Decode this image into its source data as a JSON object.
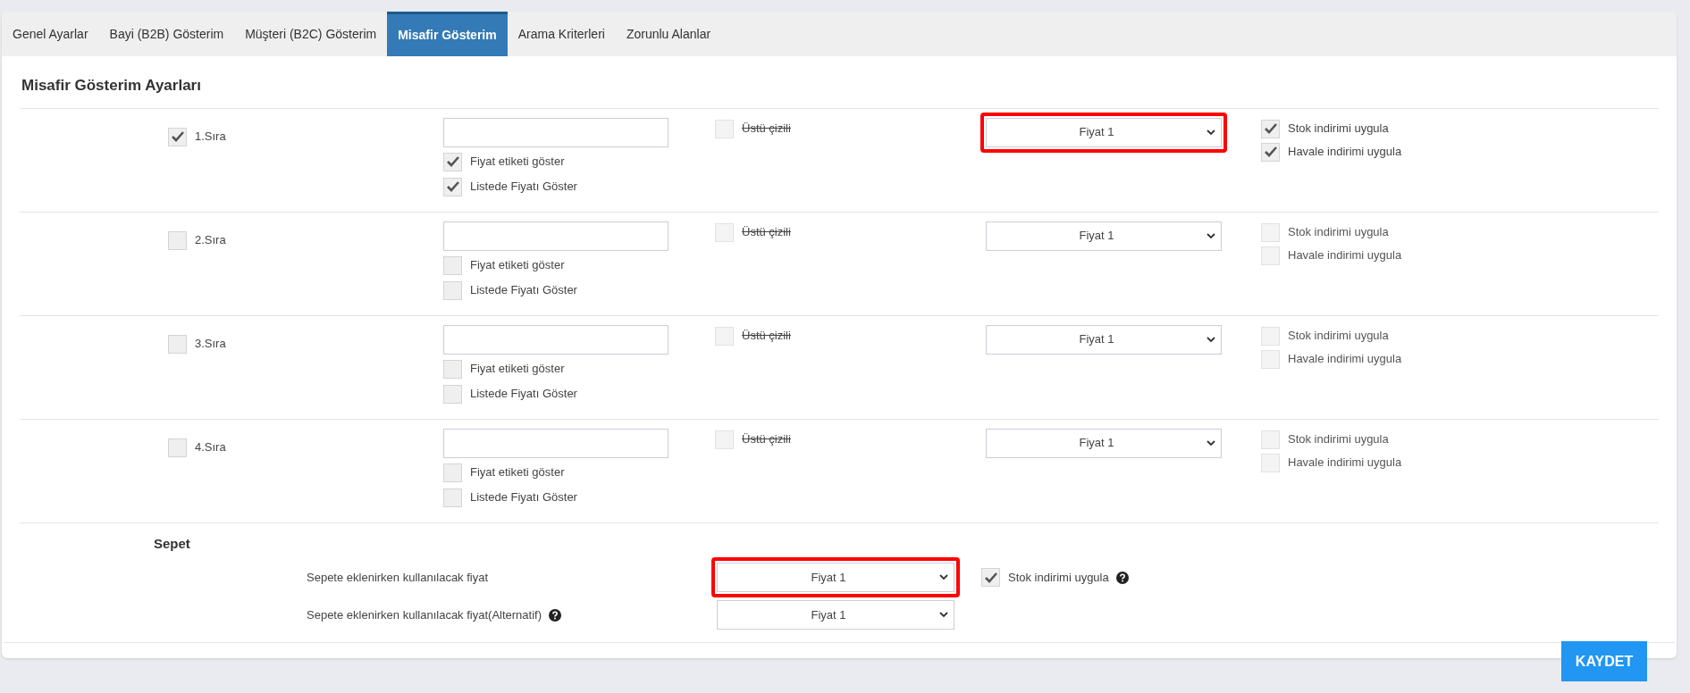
{
  "tabs": [
    {
      "label": "Genel Ayarlar",
      "selected": false
    },
    {
      "label": "Bayi (B2B) Gösterim",
      "selected": false
    },
    {
      "label": "Müşteri (B2C) Gösterim",
      "selected": false
    },
    {
      "label": "Misafir Gösterim",
      "selected": true
    },
    {
      "label": "Arama Kriterleri",
      "selected": false
    },
    {
      "label": "Zorunlu Alanlar",
      "selected": false
    }
  ],
  "heading": "Misafir Gösterim Ayarları",
  "rows": [
    {
      "order": {
        "label": "1.Sıra",
        "checked": true,
        "disabled": false
      },
      "options": [
        {
          "label": "Fiyat etiketi göster",
          "checked": true,
          "disabled": false
        },
        {
          "label": "Listede Fiyatı Göster",
          "checked": true,
          "disabled": false
        }
      ],
      "strike": {
        "label": "Üstü çizili",
        "checked": false,
        "disabled": true
      },
      "select": {
        "value": "Fiyat 1",
        "highlighted": true
      },
      "discounts": [
        {
          "label": "Stok indirimi uygula",
          "checked": true,
          "disabled": false
        },
        {
          "label": "Havale indirimi uygula",
          "checked": true,
          "disabled": false
        }
      ]
    },
    {
      "order": {
        "label": "2.Sıra",
        "checked": false,
        "disabled": false
      },
      "options": [
        {
          "label": "Fiyat etiketi göster",
          "checked": false,
          "disabled": false
        },
        {
          "label": "Listede Fiyatı Göster",
          "checked": false,
          "disabled": false
        }
      ],
      "strike": {
        "label": "Üstü çizili",
        "checked": false,
        "disabled": true
      },
      "select": {
        "value": "Fiyat 1",
        "highlighted": false
      },
      "discounts": [
        {
          "label": "Stok indirimi uygula",
          "checked": false,
          "disabled": true
        },
        {
          "label": "Havale indirimi uygula",
          "checked": false,
          "disabled": true
        }
      ]
    },
    {
      "order": {
        "label": "3.Sıra",
        "checked": false,
        "disabled": false
      },
      "options": [
        {
          "label": "Fiyat etiketi göster",
          "checked": false,
          "disabled": false
        },
        {
          "label": "Listede Fiyatı Göster",
          "checked": false,
          "disabled": false
        }
      ],
      "strike": {
        "label": "Üstü çizili",
        "checked": false,
        "disabled": true
      },
      "select": {
        "value": "Fiyat 1",
        "highlighted": false
      },
      "discounts": [
        {
          "label": "Stok indirimi uygula",
          "checked": false,
          "disabled": true
        },
        {
          "label": "Havale indirimi uygula",
          "checked": false,
          "disabled": true
        }
      ]
    },
    {
      "order": {
        "label": "4.Sıra",
        "checked": false,
        "disabled": false
      },
      "options": [
        {
          "label": "Fiyat etiketi göster",
          "checked": false,
          "disabled": false
        },
        {
          "label": "Listede Fiyatı Göster",
          "checked": false,
          "disabled": false
        }
      ],
      "strike": {
        "label": "Üstü çizili",
        "checked": false,
        "disabled": true
      },
      "select": {
        "value": "Fiyat 1",
        "highlighted": false
      },
      "discounts": [
        {
          "label": "Stok indirimi uygula",
          "checked": false,
          "disabled": true
        },
        {
          "label": "Havale indirimi uygula",
          "checked": false,
          "disabled": true
        }
      ]
    }
  ],
  "cart": {
    "title": "Sepet",
    "fields": [
      {
        "label": "Sepete eklenirken kullanılacak fiyat",
        "help": false,
        "select": {
          "value": "Fiyat 1",
          "highlighted": true
        }
      },
      {
        "label": "Sepete eklenirken kullanılacak fiyat(Alternatif)",
        "help": true,
        "select": {
          "value": "Fiyat 1",
          "highlighted": false
        }
      }
    ],
    "stock": {
      "label": "Stok indirimi uygula",
      "checked": true,
      "disabled": false,
      "help": true
    }
  },
  "save_button": "KAYDET"
}
